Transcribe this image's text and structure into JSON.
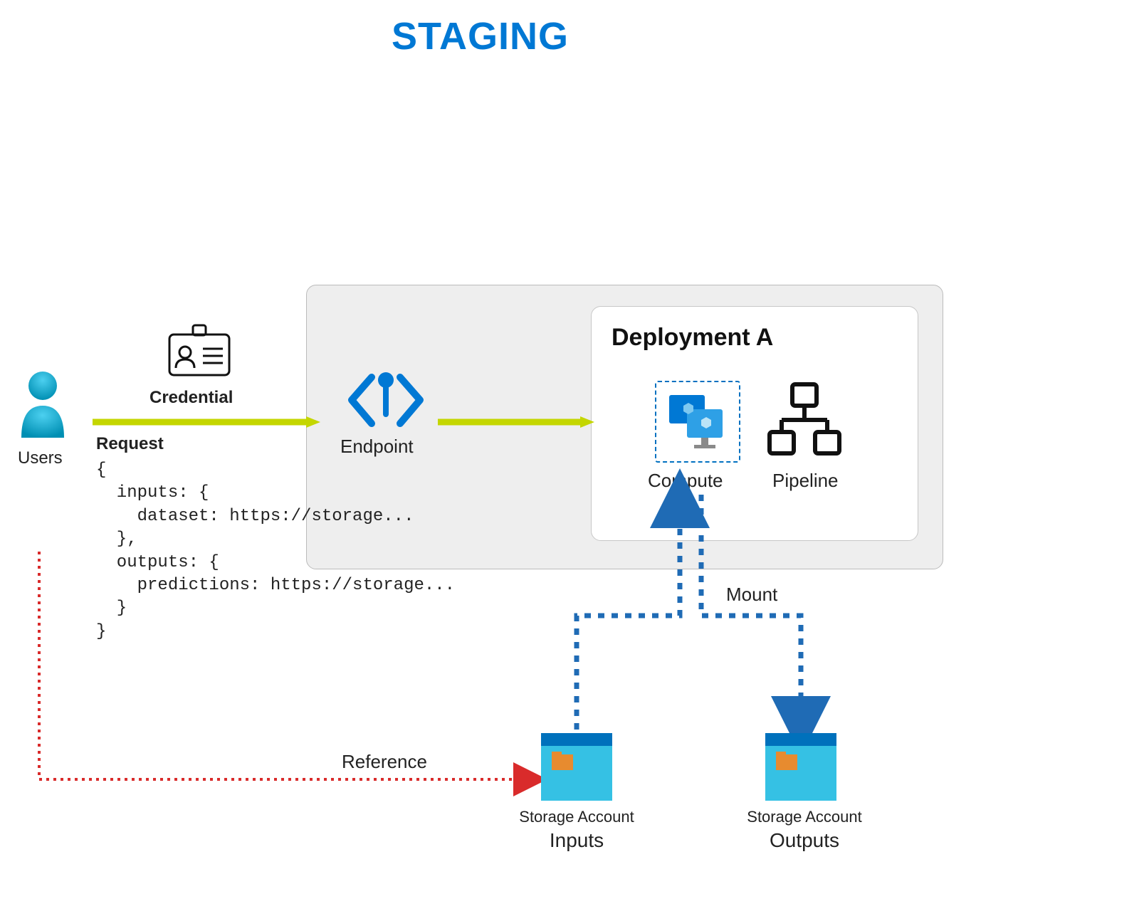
{
  "title": "STAGING",
  "users_label": "Users",
  "credential_label": "Credential",
  "endpoint_label": "Endpoint",
  "deployment_title": "Deployment A",
  "compute_label": "Compute",
  "pipeline_label": "Pipeline",
  "mount_label": "Mount",
  "reference_label": "Reference",
  "request_label": "Request",
  "request_body": "{\n  inputs: {\n    dataset: https://storage...\n  },\n  outputs: {\n    predictions: https://storage...\n  }\n}",
  "storage_inputs": {
    "label": "Storage Account",
    "sub": "Inputs"
  },
  "storage_outputs": {
    "label": "Storage Account",
    "sub": "Outputs"
  },
  "colors": {
    "title_blue": "#0078d4",
    "arrow_green": "#c4d600",
    "dotted_blue": "#1f6bb5",
    "dotted_red": "#d92b2b",
    "storage_cyan": "#29b6dc",
    "storage_top": "#0071bc"
  }
}
